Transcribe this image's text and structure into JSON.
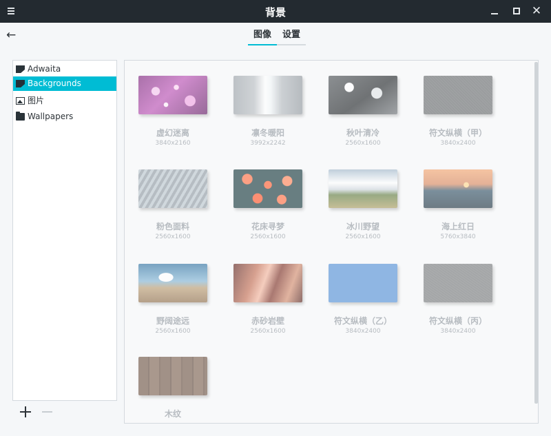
{
  "window": {
    "title": "背景"
  },
  "tabs": [
    {
      "label": "图像",
      "active": true
    },
    {
      "label": "设置",
      "active": false
    }
  ],
  "sidebar": {
    "items": [
      {
        "label": "Adwaita",
        "icon": "theme-icon",
        "selected": false
      },
      {
        "label": "Backgrounds",
        "icon": "theme-icon",
        "selected": true
      },
      {
        "label": "图片",
        "icon": "image-icon",
        "selected": false
      },
      {
        "label": "Wallpapers",
        "icon": "folder-icon",
        "selected": false
      }
    ]
  },
  "accent_color": "#00bcd4",
  "wallpapers": [
    {
      "name": "虚幻迷离",
      "size": "3840x2160"
    },
    {
      "name": "凛冬暖阳",
      "size": "3992x2242"
    },
    {
      "name": "秋叶清冷",
      "size": "2560x1600"
    },
    {
      "name": "符文纵横（甲）",
      "size": "3840x2400"
    },
    {
      "name": "粉色面料",
      "size": "2560x1600"
    },
    {
      "name": "花床寻梦",
      "size": "2560x1600"
    },
    {
      "name": "冰川野望",
      "size": "2560x1600"
    },
    {
      "name": "海上红日",
      "size": "5760x3840"
    },
    {
      "name": "野阔途远",
      "size": "2560x1600"
    },
    {
      "name": "赤砂岩壁",
      "size": "2560x1600"
    },
    {
      "name": "符文纵横（乙）",
      "size": "3840x2400"
    },
    {
      "name": "符文纵横（丙）",
      "size": "3840x2400"
    },
    {
      "name": "木纹",
      "size": ""
    }
  ]
}
